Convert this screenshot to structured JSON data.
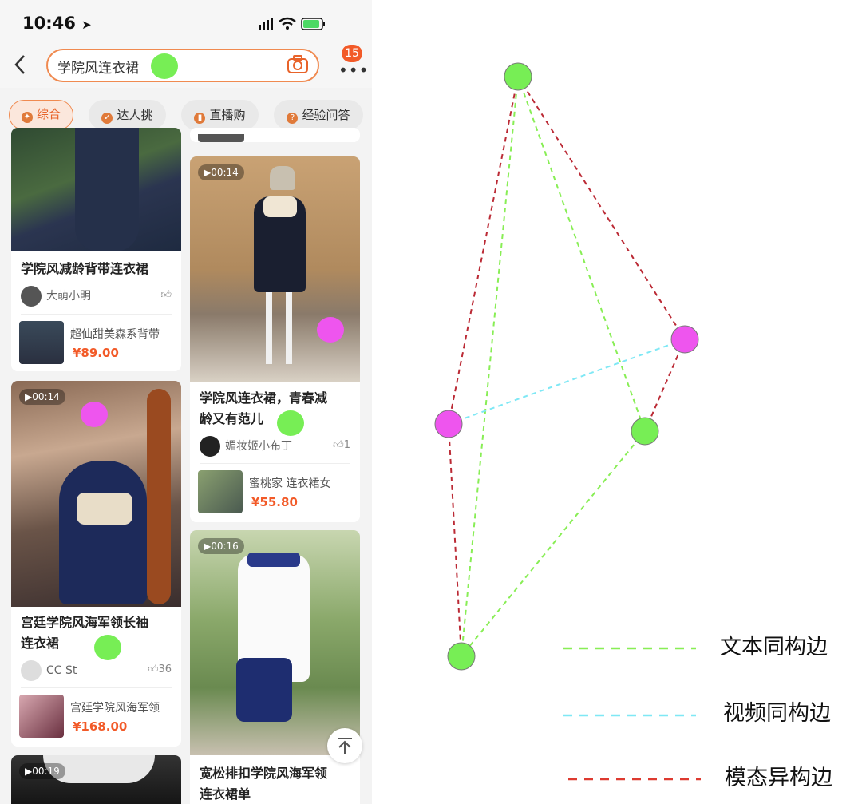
{
  "status": {
    "time": "10:46"
  },
  "search": {
    "query": "学院风连衣裙",
    "badge": "15"
  },
  "tabs": [
    {
      "label": "综合",
      "active": true
    },
    {
      "label": "达人挑",
      "active": false
    },
    {
      "label": "直播购",
      "active": false
    },
    {
      "label": "经验问答",
      "active": false
    }
  ],
  "feed_left": [
    {
      "title": "学院风减龄背带连衣裙",
      "author": "大萌小明",
      "likes": "",
      "product": "超仙甜美森系背带",
      "price": "¥89.00"
    },
    {
      "duration": "00:14",
      "title_line1": "宫廷学院风海军领长袖",
      "title_line2": "连衣裙",
      "author": "CC   St",
      "likes": "36",
      "product": "宫廷学院风海军领",
      "price": "¥168.00"
    },
    {
      "duration": "00:19"
    }
  ],
  "feed_right": [
    {
      "duration": "00:14",
      "title_line1": "学院风连衣裙，青春减",
      "title_line2": "龄又有范儿",
      "author": "媚妆姬小布丁",
      "likes": "1",
      "product": "蜜桃家 连衣裙女",
      "price": "¥55.80"
    },
    {
      "duration": "00:16",
      "title_line1": "宽松排扣学院风海军领",
      "title_line2": "连衣裙单"
    }
  ],
  "colors": {
    "text_node": "#77ee55",
    "video_node": "#ee55ee",
    "text_edge": "#88ee55",
    "video_edge": "#7fe8f5",
    "cross_edge": "#bb2a35",
    "accent": "#f08a50"
  },
  "legend": [
    {
      "label": "文本同构边",
      "color": "#88ee55"
    },
    {
      "label": "视频同构边",
      "color": "#7fe8f5"
    },
    {
      "label": "模态异构边",
      "color": "#dd3a30"
    }
  ]
}
